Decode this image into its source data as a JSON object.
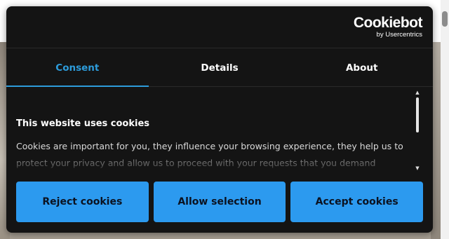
{
  "brand": {
    "name": "Cookiebot",
    "byline": "by Usercentrics"
  },
  "tabs": [
    {
      "label": "Consent",
      "active": true
    },
    {
      "label": "Details",
      "active": false
    },
    {
      "label": "About",
      "active": false
    }
  ],
  "content": {
    "title": "This website uses cookies",
    "text": "Cookies are important for you, they influence your browsing experience, they help us to protect your privacy and allow us to proceed with your requests that you demand through the website. We"
  },
  "buttons": {
    "reject_label": "Reject cookies",
    "selection_label": "Allow selection",
    "accept_label": "Accept cookies"
  },
  "colors": {
    "dialog_background": "#141414",
    "accent": "#2c9aef",
    "active_tab": "#2d9cdb",
    "text": "#ffffff"
  }
}
